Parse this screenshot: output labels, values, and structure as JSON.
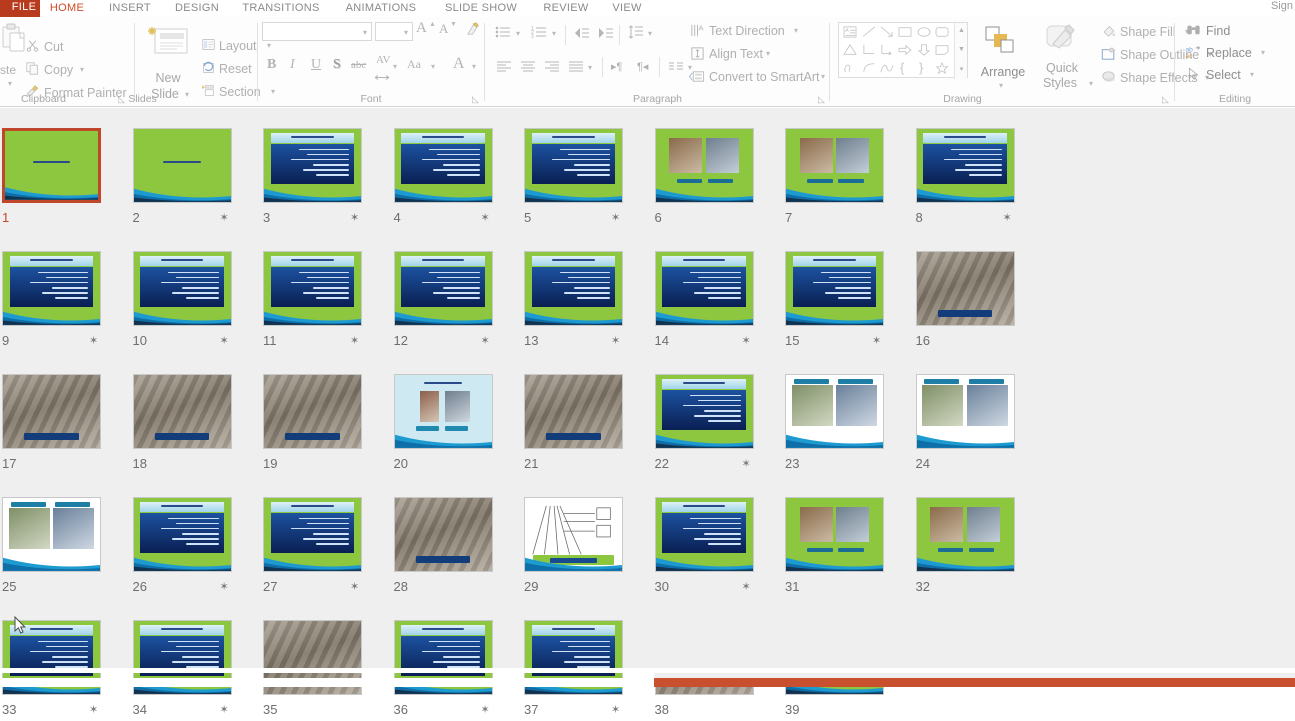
{
  "app": {
    "title": "Microsoft PowerPoint - Slide Sorter",
    "accent_color": "#d04a25",
    "file_tab_color": "#b83b1d",
    "selection_color": "#c0472a",
    "canvas_color": "#efefef"
  },
  "tabs": {
    "file_label": "FILE",
    "items": [
      {
        "label": "HOME",
        "active": true
      },
      {
        "label": "INSERT",
        "active": false
      },
      {
        "label": "DESIGN",
        "active": false
      },
      {
        "label": "TRANSITIONS",
        "active": false
      },
      {
        "label": "ANIMATIONS",
        "active": false
      },
      {
        "label": "SLIDE SHOW",
        "active": false
      },
      {
        "label": "REVIEW",
        "active": false
      },
      {
        "label": "VIEW",
        "active": false
      }
    ],
    "sign_in": "Sign"
  },
  "ribbon": {
    "clipboard": {
      "group_label": "Clipboard",
      "paste_label": "ste",
      "cut_label": "Cut",
      "copy_label": "Copy",
      "format_painter_label": "Format Painter",
      "scissors_icon": "cut-icon",
      "copy_icon": "copy-icon",
      "brush_icon": "format-painter-icon",
      "dialog_launcher": "◺"
    },
    "slides": {
      "group_label": "Slides",
      "new_slide_label_line1": "New",
      "new_slide_label_line2": "Slide",
      "layout_label": "Layout",
      "reset_label": "Reset",
      "section_label": "Section"
    },
    "font": {
      "group_label": "Font",
      "font_name_value": "",
      "font_size_value": "",
      "grow_font": "A",
      "shrink_font": "A",
      "clear_formatting": "clear-formatting-icon",
      "bold": "B",
      "italic": "I",
      "underline": "U",
      "shadow": "S",
      "strikethrough": "abc",
      "character_spacing": "AV",
      "change_case": "Aa",
      "font_color": "A",
      "dialog_launcher": "◺"
    },
    "paragraph": {
      "group_label": "Paragraph",
      "text_direction_label": "Text Direction",
      "align_text_label": "Align Text",
      "convert_smartart_label": "Convert to SmartArt",
      "dialog_launcher": "◺"
    },
    "drawing": {
      "group_label": "Drawing",
      "arrange_label": "Arrange",
      "quick_styles_line1": "Quick",
      "quick_styles_line2": "Styles",
      "shape_fill_label": "Shape Fill",
      "shape_outline_label": "Shape Outline",
      "shape_effects_label": "Shape Effects",
      "dialog_launcher": "◺"
    },
    "editing": {
      "group_label": "Editing",
      "find_label": "Find",
      "replace_label": "Replace",
      "select_label": "Select",
      "find_icon": "binoculars-icon",
      "replace_icon": "replace-icon",
      "select_icon": "pointer-icon"
    }
  },
  "sorter": {
    "selected_slide": 1,
    "columns": 8,
    "rows": 4,
    "star_glyph": "✶",
    "slides": [
      {
        "n": "1",
        "star": false,
        "kind": "title-green",
        "selected": true
      },
      {
        "n": "2",
        "star": true,
        "kind": "title-green",
        "selected": false
      },
      {
        "n": "3",
        "star": true,
        "kind": "content-green",
        "selected": false
      },
      {
        "n": "4",
        "star": true,
        "kind": "content-green",
        "selected": false
      },
      {
        "n": "5",
        "star": true,
        "kind": "content-green",
        "selected": false
      },
      {
        "n": "6",
        "star": false,
        "kind": "photo-green",
        "selected": false
      },
      {
        "n": "7",
        "star": false,
        "kind": "photo-green",
        "selected": false
      },
      {
        "n": "8",
        "star": true,
        "kind": "content-green",
        "selected": false
      },
      {
        "n": "9",
        "star": true,
        "kind": "content-green",
        "selected": false
      },
      {
        "n": "10",
        "star": true,
        "kind": "content-green",
        "selected": false
      },
      {
        "n": "11",
        "star": true,
        "kind": "content-green",
        "selected": false
      },
      {
        "n": "12",
        "star": true,
        "kind": "content-green",
        "selected": false
      },
      {
        "n": "13",
        "star": true,
        "kind": "content-green",
        "selected": false
      },
      {
        "n": "14",
        "star": true,
        "kind": "content-green",
        "selected": false
      },
      {
        "n": "15",
        "star": true,
        "kind": "content-green",
        "selected": false
      },
      {
        "n": "16",
        "star": false,
        "kind": "full-photo",
        "selected": false
      },
      {
        "n": "17",
        "star": false,
        "kind": "full-photo",
        "selected": false
      },
      {
        "n": "18",
        "star": false,
        "kind": "full-photo",
        "selected": false
      },
      {
        "n": "19",
        "star": false,
        "kind": "full-photo",
        "selected": false
      },
      {
        "n": "20",
        "star": false,
        "kind": "photo-pale",
        "selected": false
      },
      {
        "n": "21",
        "star": false,
        "kind": "full-photo",
        "selected": false
      },
      {
        "n": "22",
        "star": true,
        "kind": "content-green",
        "selected": false
      },
      {
        "n": "23",
        "star": false,
        "kind": "photo-white",
        "selected": false
      },
      {
        "n": "24",
        "star": false,
        "kind": "photo-white",
        "selected": false
      },
      {
        "n": "25",
        "star": false,
        "kind": "photo-white",
        "selected": false
      },
      {
        "n": "26",
        "star": true,
        "kind": "content-green",
        "selected": false
      },
      {
        "n": "27",
        "star": true,
        "kind": "content-green",
        "selected": false
      },
      {
        "n": "28",
        "star": false,
        "kind": "full-photo",
        "selected": false
      },
      {
        "n": "29",
        "star": false,
        "kind": "diagram-white",
        "selected": false
      },
      {
        "n": "30",
        "star": true,
        "kind": "content-green",
        "selected": false
      },
      {
        "n": "31",
        "star": false,
        "kind": "photo-green",
        "selected": false
      },
      {
        "n": "32",
        "star": false,
        "kind": "photo-green",
        "selected": false
      },
      {
        "n": "33",
        "star": true,
        "kind": "content-green",
        "selected": false
      },
      {
        "n": "34",
        "star": true,
        "kind": "content-green",
        "selected": false
      },
      {
        "n": "35",
        "star": false,
        "kind": "full-photo",
        "selected": false
      },
      {
        "n": "36",
        "star": true,
        "kind": "content-green",
        "selected": false
      },
      {
        "n": "37",
        "star": true,
        "kind": "content-green",
        "selected": false
      },
      {
        "n": "38",
        "star": false,
        "kind": "full-photo",
        "selected": false
      },
      {
        "n": "39",
        "star": false,
        "kind": "photo-green",
        "selected": false
      }
    ]
  }
}
